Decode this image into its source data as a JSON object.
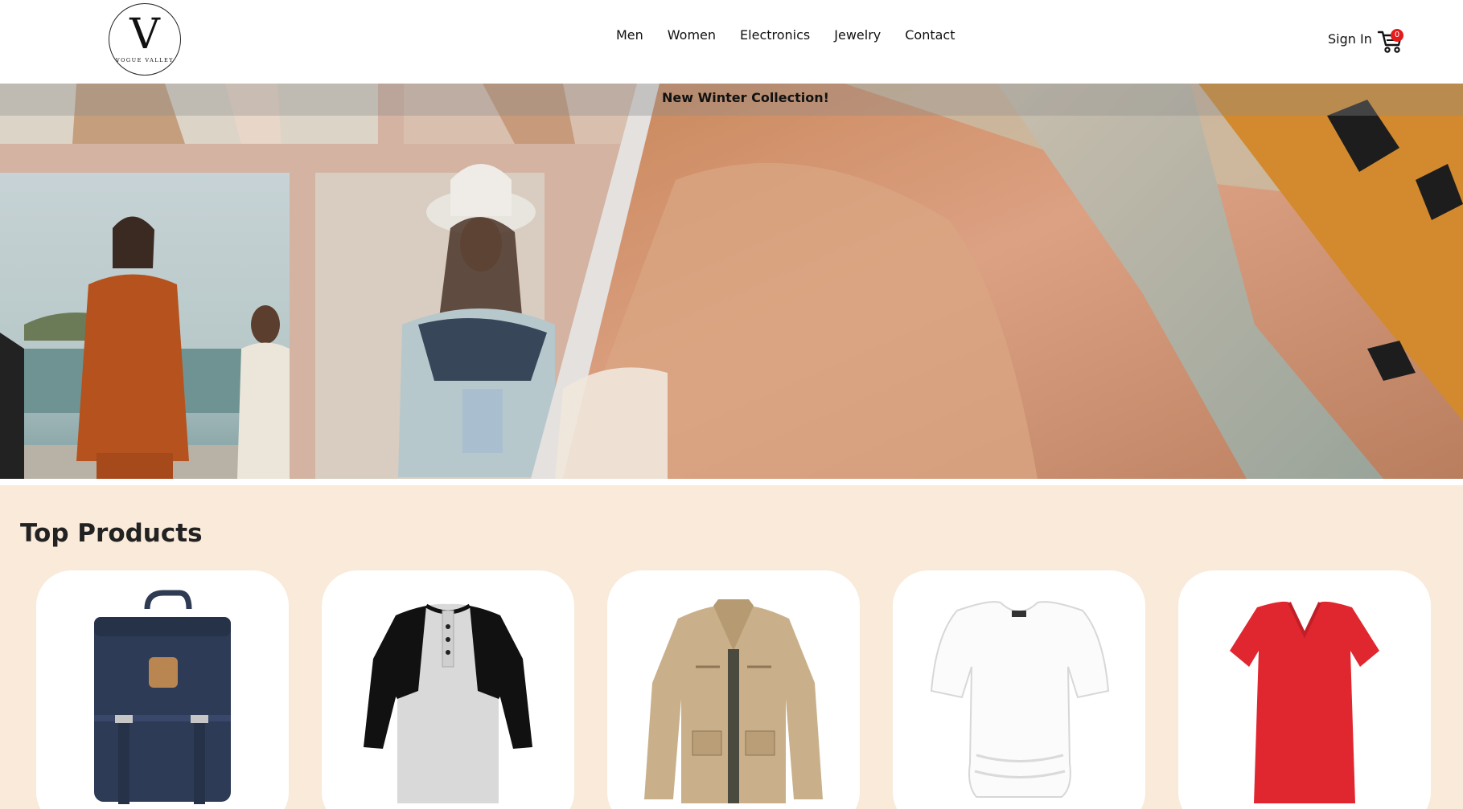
{
  "brand": {
    "logo_letter": "V",
    "logo_text": "VOGUE VALLEY"
  },
  "nav": {
    "items": [
      "Men",
      "Women",
      "Electronics",
      "Jewelry",
      "Contact"
    ]
  },
  "header": {
    "signin_label": "Sign In",
    "cart_count": "0"
  },
  "hero": {
    "announcement": "New Winter Collection!"
  },
  "products": {
    "title": "Top Products",
    "items": [
      {
        "image": "backpack-image"
      },
      {
        "image": "raglan-tshirt-image"
      },
      {
        "image": "jacket-image"
      },
      {
        "image": "white-top-image"
      },
      {
        "image": "red-tshirt-image"
      }
    ]
  },
  "colors": {
    "page_bg": "#f9ead9",
    "header_bg": "#ffffff",
    "badge": "#e51b1b",
    "card_bg": "#ffffff"
  }
}
